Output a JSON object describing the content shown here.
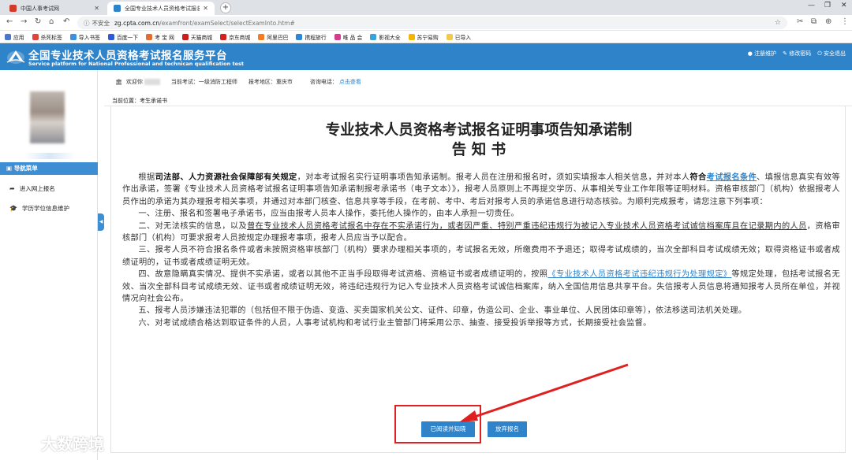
{
  "browser": {
    "tabs": [
      {
        "title": "中国人事考试网",
        "favicon_color": "#d23a2c"
      },
      {
        "title": "全国专业技术人员资格考试报名...",
        "favicon_color": "#2f83c9"
      }
    ],
    "address": {
      "security": "不安全",
      "host": "zg.cpta.com.cn",
      "path": "/examfront/examSelect/selectExamInto.htm#"
    },
    "bookmarks": [
      {
        "label": "应用",
        "color": "#4a77c9"
      },
      {
        "label": "杀死标签",
        "color": "#e2423a"
      },
      {
        "label": "导入书签",
        "color": "#3d8fe0"
      },
      {
        "label": "百度一下",
        "color": "#2f5ad5"
      },
      {
        "label": "考 宝 网",
        "color": "#e66b2e"
      },
      {
        "label": "天猫商城",
        "color": "#cc1d1d"
      },
      {
        "label": "京东商城",
        "color": "#d71f1f"
      },
      {
        "label": "阿里巴巴",
        "color": "#f57a22"
      },
      {
        "label": "携程旅行",
        "color": "#2d86d8"
      },
      {
        "label": "唯 品 会",
        "color": "#d83a8d"
      },
      {
        "label": "影视大全",
        "color": "#3aa1d9"
      },
      {
        "label": "苏宁易购",
        "color": "#f4b400"
      },
      {
        "label": "已导入",
        "color": "#f2c94c"
      }
    ]
  },
  "site": {
    "title": "全国专业技术人员资格考试报名服务平台",
    "subtitle": "Service platform for National Professional and technican qualification test",
    "header_links": [
      "注册维护",
      "修改密码",
      "安全退出"
    ],
    "brand_color": "#2f83c9"
  },
  "sidebar": {
    "nav_header": "导航菜单",
    "items": [
      {
        "label": "进入网上报名",
        "icon": "share-arrow-icon"
      },
      {
        "label": "学历学位信息维护",
        "icon": "graduation-cap-icon"
      }
    ]
  },
  "infobar": {
    "welcome": "欢迎你",
    "exam_label": "当前考试：",
    "exam_value": "一级消防工程师",
    "region_label": "报考地区：",
    "region_value": "重庆市",
    "phone_label": "咨询电话：",
    "phone_link": "点击查看"
  },
  "breadcrumb": "当前位置：考生承诺书",
  "document": {
    "title_line1": "专业技术人员资格考试报名证明事项告知承诺制",
    "title_line2": "告 知 书",
    "p1_a": "根据",
    "p1_b": "司法部、人力资源社会保障部有关规定",
    "p1_c": "，对本考试报名实行证明事项告知承诺制。报考人员在注册和报名时，须如实填报本人相关信息，并对本人",
    "p1_d": "符合",
    "p1_e": "考试报名条件",
    "p1_f": "、填报信息真实有效等作出承诺，签署《专业技术人员资格考试报名证明事项告知承诺制报考承诺书（电子文本）》，报考人员原则上不再提交学历、从事相关专业工作年限等证明材料。资格审核部门（机构）依据报考人员作出的承诺为其办理报考相关事项，并通过对本部门核查、信息共享等手段，在考前、考中、考后对报考人员的承诺信息进行动态核验。为顺利完成报考，请您注意下列事项：",
    "p2": "一、注册、报名和签署电子承诺书，应当由报考人员本人操作，委托他人操作的，由本人承担一切责任。",
    "p3_a": "二、对无法核实的信息，以及",
    "p3_b": "曾在专业技术人员资格考试报名中存在不实承诺行为，或者因严重、特别严重违纪违规行为被记入专业技术人员资格考试诚信档案库且在记录期内的人员",
    "p3_c": "，资格审核部门（机构）可要求报考人员按规定办理报考事项，报考人员应当予以配合。",
    "p4": "三、报考人员不符合报名条件或者未按照资格审核部门（机构）要求办理相关事项的，考试报名无效，所缴费用不予退还；取得考试成绩的，当次全部科目考试成绩无效；取得资格证书或者成绩证明的，证书或者成绩证明无效。",
    "p5_a": "四、故意隐瞒真实情况、提供不实承诺，或者以其他不正当手段取得考试资格、资格证书或者成绩证明的，按照",
    "p5_b": "《专业技术人员资格考试违纪违规行为处理规定》",
    "p5_c": "等规定处理，包括考试报名无效、当次全部科目考试成绩无效、证书或者成绩证明无效，将违纪违规行为记入专业技术人员资格考试诚信档案库，纳入全国信用信息共享平台。失信报考人员信息将通知报考人员所在单位，并视情况向社会公布。",
    "p6": "五、报考人员涉嫌违法犯罪的（包括但不限于伪造、变造、买卖国家机关公文、证件、印章，伪造公司、企业、事业单位、人民团体印章等），依法移送司法机关处理。",
    "p7": "六、对考试成绩合格达到取证条件的人员，人事考试机构和考试行业主管部门将采用公示、抽查、接受投诉举报等方式，长期接受社会监督。"
  },
  "buttons": {
    "agree": "已阅读并知晓",
    "giveup": "放弃报名"
  },
  "watermark": "大数跨境"
}
